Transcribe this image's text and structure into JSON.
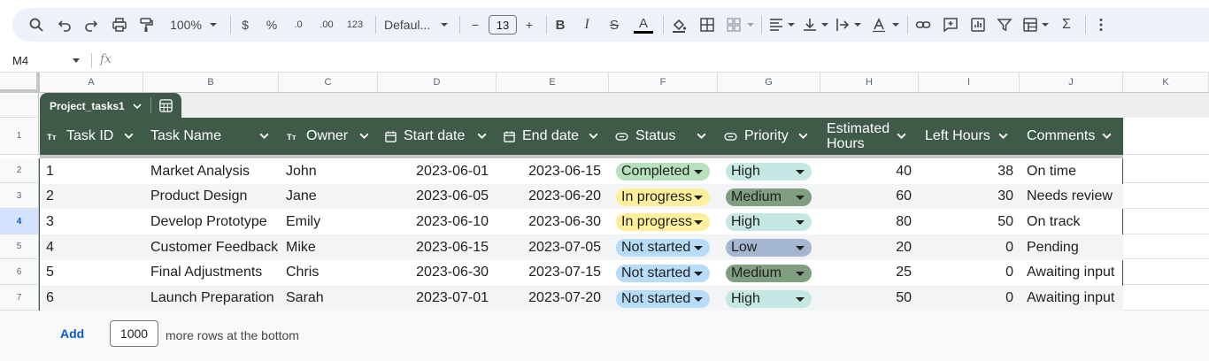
{
  "toolbar": {
    "zoom": "100%",
    "currency": "$",
    "percent": "%",
    "decrease_decimal": ".0",
    "increase_decimal": ".00",
    "number_format": "123",
    "font": "Defaul...",
    "font_size": "13",
    "minus": "−",
    "plus": "+",
    "bold": "B",
    "italic": "I",
    "strike": "S",
    "text_color": "A",
    "sum": "Σ"
  },
  "formula_bar": {
    "cell_ref": "M4",
    "fx": "fx"
  },
  "columns": [
    "A",
    "B",
    "C",
    "D",
    "E",
    "F",
    "G",
    "H",
    "I",
    "J",
    "K"
  ],
  "row_numbers": [
    "1",
    "2",
    "3",
    "4",
    "5",
    "6",
    "7"
  ],
  "selected_row": "4",
  "table": {
    "name": "Project_tasks1",
    "headers": {
      "task_id": "Task ID",
      "task_name": "Task Name",
      "owner": "Owner",
      "start_date": "Start date",
      "end_date": "End date",
      "status": "Status",
      "priority": "Priority",
      "estimated_hours_1": "Estimated",
      "estimated_hours_2": "Hours",
      "left_hours": "Left Hours",
      "comments": "Comments"
    },
    "rows": [
      {
        "id": "1",
        "name": "Market Analysis",
        "owner": "John",
        "start": "2023-06-01",
        "end": "2023-06-15",
        "status": "Completed",
        "priority": "High",
        "est": "40",
        "left": "38",
        "comment": "On time"
      },
      {
        "id": "2",
        "name": "Product Design",
        "owner": "Jane",
        "start": "2023-06-05",
        "end": "2023-06-20",
        "status": "In progress",
        "priority": "Medium",
        "est": "60",
        "left": "30",
        "comment": "Needs review"
      },
      {
        "id": "3",
        "name": "Develop Prototype",
        "owner": "Emily",
        "start": "2023-06-10",
        "end": "2023-06-30",
        "status": "In progress",
        "priority": "High",
        "est": "80",
        "left": "50",
        "comment": "On track"
      },
      {
        "id": "4",
        "name": "Customer Feedback",
        "owner": "Mike",
        "start": "2023-06-15",
        "end": "2023-07-05",
        "status": "Not started",
        "priority": "Low",
        "est": "20",
        "left": "0",
        "comment": "Pending"
      },
      {
        "id": "5",
        "name": "Final Adjustments",
        "owner": "Chris",
        "start": "2023-06-30",
        "end": "2023-07-15",
        "status": "Not started",
        "priority": "Medium",
        "est": "25",
        "left": "0",
        "comment": "Awaiting input"
      },
      {
        "id": "6",
        "name": "Launch Preparation",
        "owner": "Sarah",
        "start": "2023-07-01",
        "end": "2023-07-20",
        "status": "Not started",
        "priority": "High",
        "est": "50",
        "left": "0",
        "comment": "Awaiting input"
      }
    ]
  },
  "colors": {
    "header_bg": "#3f5a49",
    "status_completed": "#b7e1bd",
    "status_in_progress": "#fdef9b",
    "status_not_started": "#b6dcf7",
    "priority_high": "#c6e8e5",
    "priority_medium": "#7f9f80",
    "priority_low": "#a5b7d0"
  },
  "footer": {
    "add_label": "Add",
    "rows_count": "1000",
    "suffix": "more rows at the bottom"
  }
}
